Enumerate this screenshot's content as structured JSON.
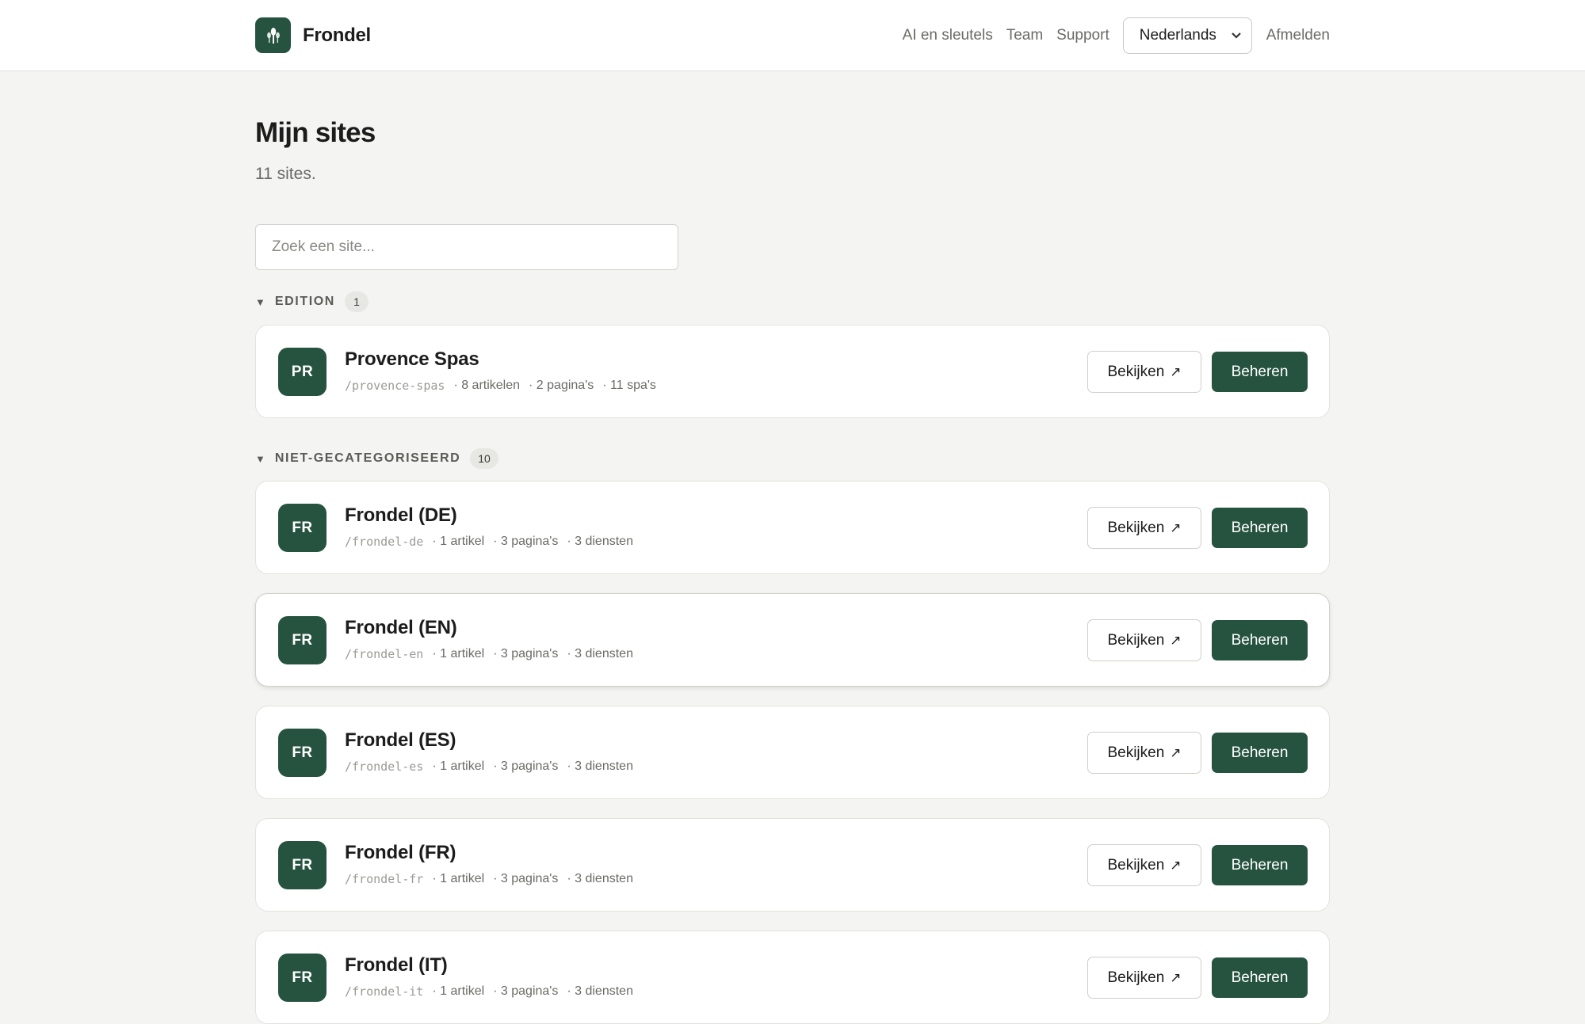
{
  "header": {
    "brand": "Frondel",
    "nav": [
      "AI en sleutels",
      "Team",
      "Support"
    ],
    "language": "Nederlands",
    "logout": "Afmelden"
  },
  "page": {
    "title": "Mijn sites",
    "subtitle": "11 sites.",
    "search_placeholder": "Zoek een site..."
  },
  "groups": [
    {
      "name": "EDITION",
      "count": "1",
      "sites": [
        {
          "initials": "PR",
          "name": "Provence Spas",
          "slug": "/provence-spas",
          "meta": [
            "· 8 artikelen",
            "· 2 pagina's",
            "· 11 spa's"
          ]
        }
      ]
    },
    {
      "name": "NIET-GECATEGORISEERD",
      "count": "10",
      "sites": [
        {
          "initials": "FR",
          "name": "Frondel (DE)",
          "slug": "/frondel-de",
          "meta": [
            "· 1 artikel",
            "· 3 pagina's",
            "· 3 diensten"
          ]
        },
        {
          "initials": "FR",
          "name": "Frondel (EN)",
          "slug": "/frondel-en",
          "meta": [
            "· 1 artikel",
            "· 3 pagina's",
            "· 3 diensten"
          ]
        },
        {
          "initials": "FR",
          "name": "Frondel (ES)",
          "slug": "/frondel-es",
          "meta": [
            "· 1 artikel",
            "· 3 pagina's",
            "· 3 diensten"
          ]
        },
        {
          "initials": "FR",
          "name": "Frondel (FR)",
          "slug": "/frondel-fr",
          "meta": [
            "· 1 artikel",
            "· 3 pagina's",
            "· 3 diensten"
          ]
        },
        {
          "initials": "FR",
          "name": "Frondel (IT)",
          "slug": "/frondel-it",
          "meta": [
            "· 1 artikel",
            "· 3 pagina's",
            "· 3 diensten"
          ]
        }
      ]
    }
  ],
  "buttons": {
    "view": "Bekijken",
    "view_icon": "external-link-arrow-icon",
    "manage": "Beheren"
  },
  "colors": {
    "accent": "#26533f",
    "background": "#f4f4f2"
  }
}
